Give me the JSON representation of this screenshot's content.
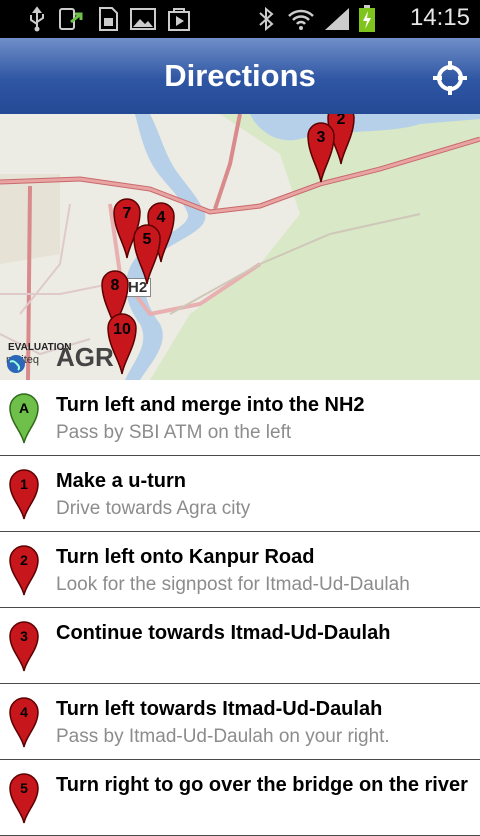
{
  "status_bar": {
    "time": "14:15",
    "icons": [
      "usb-icon",
      "phone-transfer-icon",
      "sd-card-icon",
      "image-icon",
      "play-store-icon",
      "bluetooth-icon",
      "wifi-icon",
      "signal-icon",
      "battery-charging-icon"
    ]
  },
  "header": {
    "title": "Directions",
    "action_icon": "my-location-icon"
  },
  "map": {
    "city_label": "AGR",
    "highway_label": "H2",
    "evaluation_label": "EVALUATION",
    "provider_label": "nutiteq",
    "markers": [
      "2",
      "3",
      "4",
      "5",
      "7",
      "8",
      "10"
    ]
  },
  "directions": [
    {
      "marker": "A",
      "color": "#6fc04b",
      "main": "Turn left and merge into the NH2",
      "sub": "Pass by SBI ATM on the left"
    },
    {
      "marker": "1",
      "color": "#c8161d",
      "main": "Make a u-turn",
      "sub": "Drive towards Agra city"
    },
    {
      "marker": "2",
      "color": "#c8161d",
      "main": "Turn left onto Kanpur Road",
      "sub": "Look for the signpost for Itmad-Ud-Daulah"
    },
    {
      "marker": "3",
      "color": "#c8161d",
      "main": "Continue towards Itmad-Ud-Daulah",
      "sub": ""
    },
    {
      "marker": "4",
      "color": "#c8161d",
      "main": "Turn left towards Itmad-Ud-Daulah",
      "sub": "Pass by Itmad-Ud-Daulah on your right."
    },
    {
      "marker": "5",
      "color": "#c8161d",
      "main": "Turn right to go over the bridge on the river",
      "sub": ""
    }
  ]
}
